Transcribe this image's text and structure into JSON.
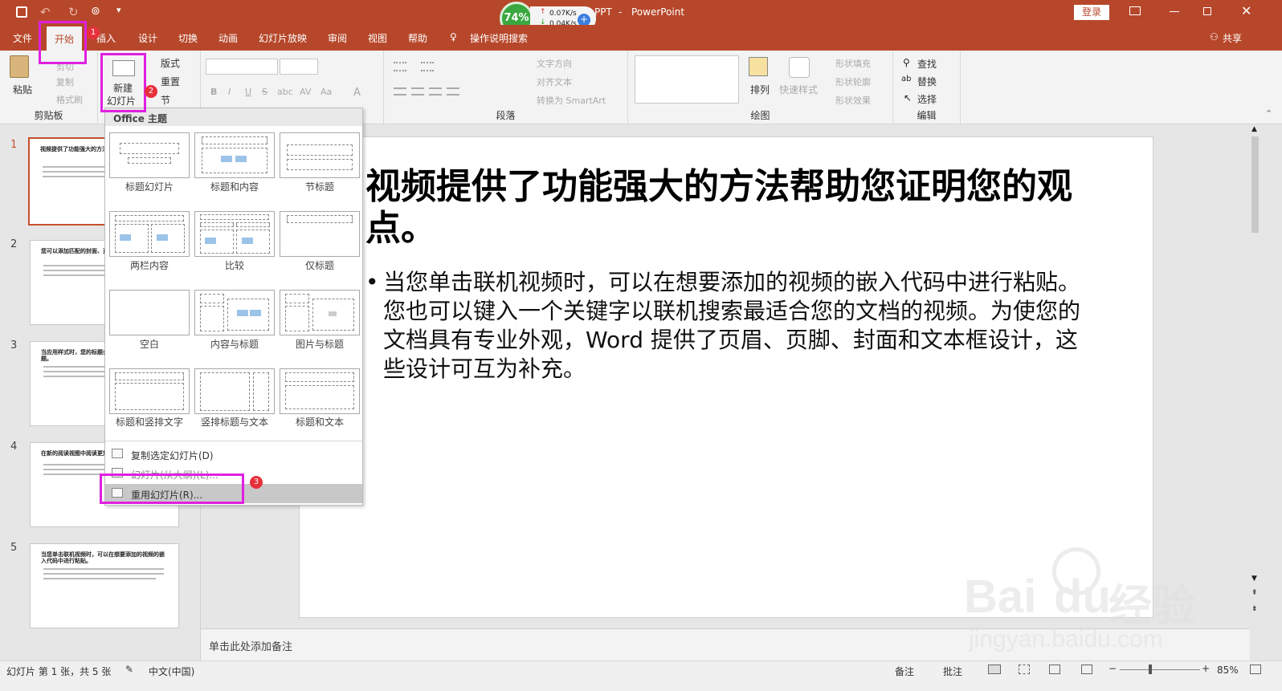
{
  "window": {
    "title_prefix": "PPT",
    "app_name": "PowerPoint",
    "login_label": "登录",
    "share_label": "共享"
  },
  "net_widget": {
    "percent": "74%",
    "up_speed": "0.07K/s",
    "down_speed": "0.04K/s"
  },
  "tabs": [
    "文件",
    "开始",
    "插入",
    "设计",
    "切换",
    "动画",
    "幻灯片放映",
    "审阅",
    "视图",
    "帮助"
  ],
  "tell_me": "操作说明搜索",
  "active_tab": "开始",
  "ribbon": {
    "clipboard": {
      "label": "剪贴板",
      "paste": "粘贴",
      "cut": "剪切",
      "copy": "复制",
      "format_painter": "格式刷"
    },
    "slides": {
      "new_slide_line1": "新建",
      "new_slide_line2": "幻灯片",
      "layout": "版式",
      "reset": "重置",
      "section": "节"
    },
    "font": {
      "bold": "B",
      "italic": "I",
      "underline": "U",
      "strike": "S",
      "shadow": "abc",
      "spacing": "AV",
      "case": "Aa",
      "color": "A"
    },
    "paragraph": {
      "label": "段落",
      "text_direction": "文字方向",
      "align_text": "对齐文本",
      "smartart": "转换为 SmartArt"
    },
    "drawing": {
      "label": "绘图",
      "arrange": "排列",
      "quick_styles": "快速样式",
      "shape_fill": "形状填充",
      "shape_outline": "形状轮廓",
      "shape_effects": "形状效果"
    },
    "editing": {
      "label": "编辑",
      "find": "查找",
      "replace": "替换",
      "select": "选择"
    }
  },
  "dropdown": {
    "header": "Office 主题",
    "layouts": [
      "标题幻灯片",
      "标题和内容",
      "节标题",
      "两栏内容",
      "比较",
      "仅标题",
      "空白",
      "内容与标题",
      "图片与标题",
      "标题和竖排文字",
      "竖排标题与文本",
      "标题和文本"
    ],
    "items": [
      "复制选定幻灯片(D)",
      "幻灯片(从大纲)(L)...",
      "重用幻灯片(R)..."
    ]
  },
  "annotations": [
    "1",
    "2",
    "3"
  ],
  "thumbnails": [
    {
      "num": "1",
      "title": "视频提供了功能强大的方法帮助您证明您的观点。"
    },
    {
      "num": "2",
      "title": "您可以添加匹配的封面、页眉和提要栏。"
    },
    {
      "num": "3",
      "title": "当应用样式时，您的标题会进行更改以匹配新的主题。"
    },
    {
      "num": "4",
      "title": "在新的阅读视图中阅读更加容易。"
    },
    {
      "num": "5",
      "title": "当您单击联机视频时，可以在想要添加的视频的嵌入代码中进行粘贴。"
    }
  ],
  "slide": {
    "title": "视频提供了功能强大的方法帮助您证明您的观点。",
    "body": "当您单击联机视频时，可以在想要添加的视频的嵌入代码中进行粘贴。您也可以键入一个关键字以联机搜索最适合您的文档的视频。为使您的文档具有专业外观，Word 提供了页眉、页脚、封面和文本框设计，这些设计可互为补充。"
  },
  "notes_placeholder": "单击此处添加备注",
  "status": {
    "slide_info": "幻灯片 第 1 张，共 5 张",
    "language": "中文(中国)",
    "notes": "备注",
    "comments": "批注",
    "zoom": "85%"
  },
  "watermark": {
    "line1": "Bai",
    "line2": "du",
    "line3": "经验",
    "url": "jingyan.baidu.com"
  },
  "colors": {
    "accent": "#b7472a",
    "highlight": "#e020e0",
    "badge": "#e8303a"
  }
}
